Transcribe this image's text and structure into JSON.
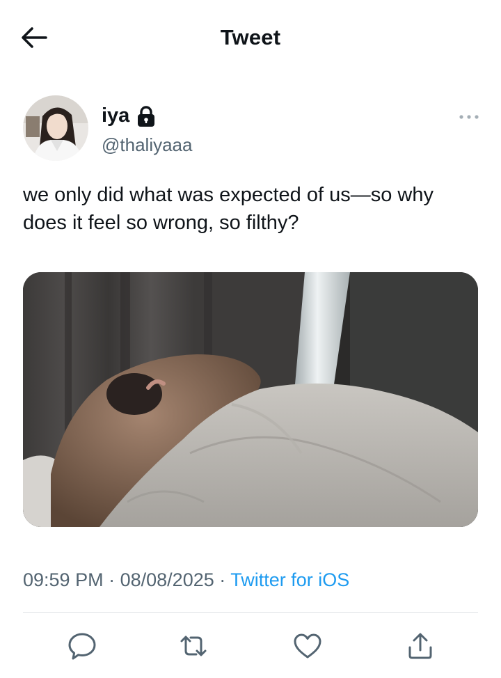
{
  "header": {
    "title": "Tweet",
    "back_icon": "arrow-left-icon"
  },
  "author": {
    "display_name": "iya",
    "handle": "@thaliyaaa",
    "protected_icon": "lock-icon",
    "more_icon": "more-horizontal-icon"
  },
  "tweet": {
    "text": "we only did what was expected of us—so why does it feel so wrong, so filthy?",
    "time": "09:59 PM",
    "separator": "·",
    "date": "08/08/2025",
    "source": "Twitter for iOS"
  },
  "actions": {
    "reply_icon": "reply-icon",
    "retweet_icon": "retweet-icon",
    "like_icon": "heart-icon",
    "share_icon": "share-icon"
  },
  "colors": {
    "text": "#0f1419",
    "secondary": "#536471",
    "link": "#1d9bf0",
    "divider": "#dfe3e6"
  }
}
